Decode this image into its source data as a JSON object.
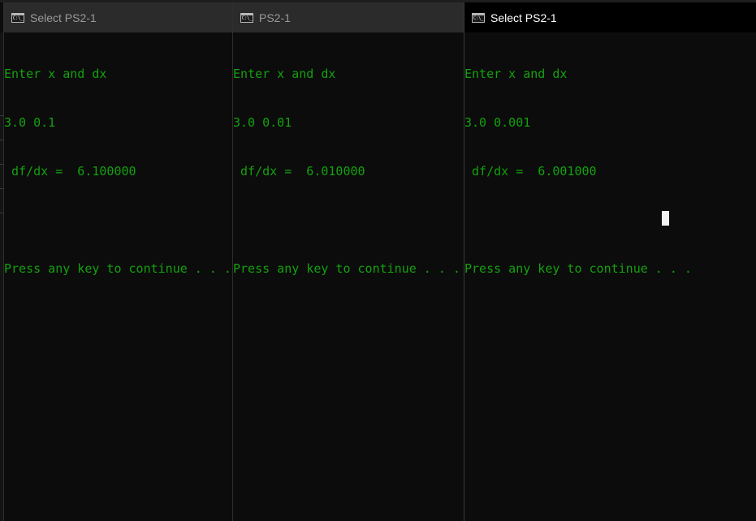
{
  "windows": [
    {
      "title": "Select PS2-1",
      "icon": "cmd-icon",
      "lines": [
        "Enter x and dx",
        "3.0 0.1",
        " df/dx =  6.100000",
        "",
        "Press any key to continue . . ."
      ]
    },
    {
      "title": "PS2-1",
      "icon": "cmd-icon",
      "lines": [
        "Enter x and dx",
        "3.0 0.01",
        " df/dx =  6.010000",
        "",
        "Press any key to continue . . ."
      ]
    },
    {
      "title": "Select PS2-1",
      "icon": "cmd-icon",
      "lines": [
        "Enter x and dx",
        "3.0 0.001",
        " df/dx =  6.001000",
        "",
        "Press any key to continue . . ."
      ]
    }
  ],
  "icon_label": "C:\\_",
  "colors": {
    "console_bg": "#0c0c0c",
    "console_text": "#13a10e",
    "titlebar_inactive": "#2b2b2b",
    "titlebar_active": "#000000",
    "cursor": "#f2f2f2"
  }
}
